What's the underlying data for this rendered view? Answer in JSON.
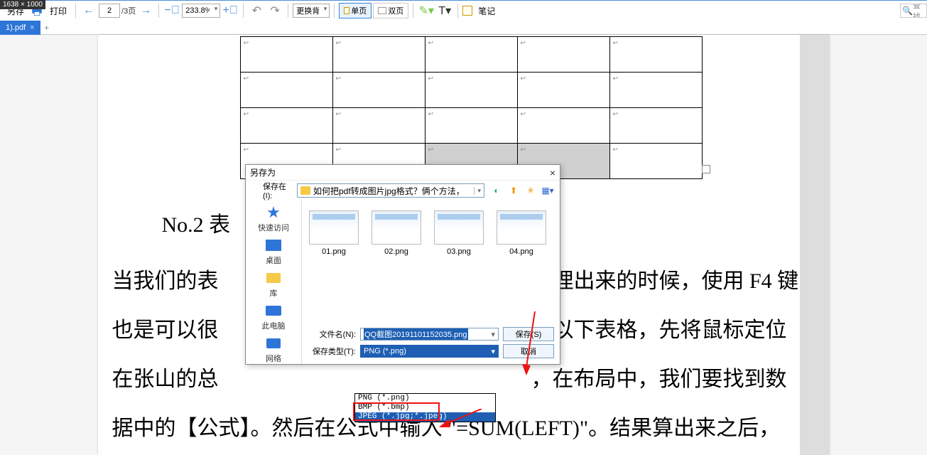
{
  "badge": "1638 × 1000",
  "toolbar": {
    "saveas": "另存",
    "print": "打印",
    "page_current": "2",
    "page_total": "/3页",
    "zoom": "233.8%",
    "bg": "更换背景",
    "single": "单页",
    "double": "双页",
    "note": "笔记",
    "search_placeholder": "查找"
  },
  "tab": {
    "name": "1).pdf"
  },
  "doc": {
    "heading": "No.2 表",
    "p1a": "当我们的表",
    "p1b": "整理出来的时候，使用 F4 键",
    "p2a": "也是可以很",
    "p2b": "如以下表格，先将鼠标定位",
    "p3a": "在张山的总",
    "p3b": "，在布局中，我们要找到数",
    "p4": "据中的【公式】。然后在公式中输入 \"=SUM(LEFT)\"。结果算出来之后，"
  },
  "dialog": {
    "title": "另存为",
    "save_in": "保存在(I):",
    "path": "如何把pdf转成图片jpg格式？俩个方法，",
    "sidebar": {
      "quick": "快速访问",
      "desktop": "桌面",
      "lib": "库",
      "pc": "此电脑",
      "net": "网络"
    },
    "thumbs": [
      "01.png",
      "02.png",
      "03.png",
      "04.png"
    ],
    "filename_label": "文件名(N):",
    "filename_value": "QQ截图20191101152035.png",
    "filetype_label": "保存类型(T):",
    "filetype_value": "PNG (*.png)",
    "save_btn": "保存(S)",
    "cancel_btn": "取消",
    "options": [
      "PNG (*.png)",
      "BMP (*.bmp)",
      "JPEG (*.jpg;*.jpeg)"
    ]
  }
}
